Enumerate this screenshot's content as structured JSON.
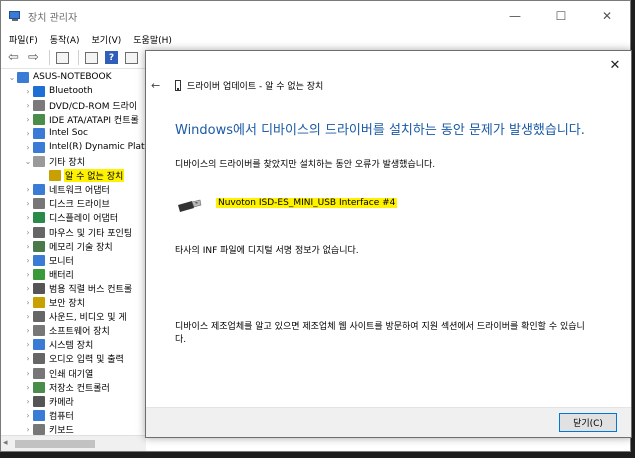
{
  "window": {
    "title": "장치 관리자",
    "minimize": "—",
    "maximize": "☐",
    "close": "✕"
  },
  "menu": [
    "파일(F)",
    "동작(A)",
    "보기(V)",
    "도움말(H)"
  ],
  "tree": {
    "root": "ASUS-NOTEBOOK",
    "items": [
      {
        "label": "Bluetooth",
        "icon": "bluetooth-icon",
        "color": "#1d6fd6"
      },
      {
        "label": "DVD/CD-ROM 드라이",
        "icon": "dvd-drive-icon",
        "color": "#7a7a7a"
      },
      {
        "label": "IDE ATA/ATAPI 컨트롤",
        "icon": "ide-controller-icon",
        "color": "#4a8c4a"
      },
      {
        "label": "Intel Soc",
        "icon": "intel-soc-icon",
        "color": "#3a7bd5"
      },
      {
        "label": "Intel(R) Dynamic Platf",
        "icon": "intel-dynamic-icon",
        "color": "#3a7bd5"
      },
      {
        "label": "기타 장치",
        "icon": "other-devices-icon",
        "color": "#9a9a9a"
      },
      {
        "label": "알 수 없는 장치",
        "icon": "unknown-device-icon",
        "color": "#c8a000"
      },
      {
        "label": "네트워크 어댑터",
        "icon": "network-adapter-icon",
        "color": "#3a7bd5"
      },
      {
        "label": "디스크 드라이브",
        "icon": "disk-drive-icon",
        "color": "#777777"
      },
      {
        "label": "디스플레이 어댑터",
        "icon": "display-adapter-icon",
        "color": "#2a8a4a"
      },
      {
        "label": "마우스 및 기타 포인팅",
        "icon": "mouse-icon",
        "color": "#666666"
      },
      {
        "label": "메모리 기술 장치",
        "icon": "memory-icon",
        "color": "#4a7a4a"
      },
      {
        "label": "모니터",
        "icon": "monitor-icon",
        "color": "#3a7bd5"
      },
      {
        "label": "배터리",
        "icon": "battery-icon",
        "color": "#3a9a3a"
      },
      {
        "label": "범용 직렬 버스 컨트롤",
        "icon": "usb-controller-icon",
        "color": "#555555"
      },
      {
        "label": "보안 장치",
        "icon": "security-icon",
        "color": "#c8a000"
      },
      {
        "label": "사운드, 비디오 및 게",
        "icon": "sound-icon",
        "color": "#666666"
      },
      {
        "label": "소프트웨어 장치",
        "icon": "software-device-icon",
        "color": "#777777"
      },
      {
        "label": "시스템 장치",
        "icon": "system-device-icon",
        "color": "#3a7bd5"
      },
      {
        "label": "오디오 입력 및 출력",
        "icon": "audio-icon",
        "color": "#666666"
      },
      {
        "label": "인쇄 대기열",
        "icon": "printer-icon",
        "color": "#777777"
      },
      {
        "label": "저장소 컨트롤러",
        "icon": "storage-controller-icon",
        "color": "#4a8c4a"
      },
      {
        "label": "카메라",
        "icon": "camera-icon",
        "color": "#555555"
      },
      {
        "label": "컴퓨터",
        "icon": "computer-icon",
        "color": "#3a7bd5"
      },
      {
        "label": "키보드",
        "icon": "keyboard-icon",
        "color": "#777777"
      }
    ]
  },
  "dialog": {
    "close": "✕",
    "back": "←",
    "title": "드라이버 업데이트 - 알 수 없는 장치",
    "heading": "Windows에서 디바이스의 드라이버를 설치하는 동안 문제가 발생했습니다.",
    "line1": "디바이스의 드라이버를 찾았지만 설치하는 동안 오류가 발생했습니다.",
    "device_name": "Nuvoton ISD-ES_MINI_USB Interface #4",
    "line2": "타사의 INF 파일에 디지털 서명 정보가 없습니다.",
    "line3": "디바이스 제조업체를 알고 있으면 제조업체 웹 사이트를 방문하여 지원 섹션에서 드라이버를 확인할 수 있습니다.",
    "close_button": "닫기(C)"
  }
}
